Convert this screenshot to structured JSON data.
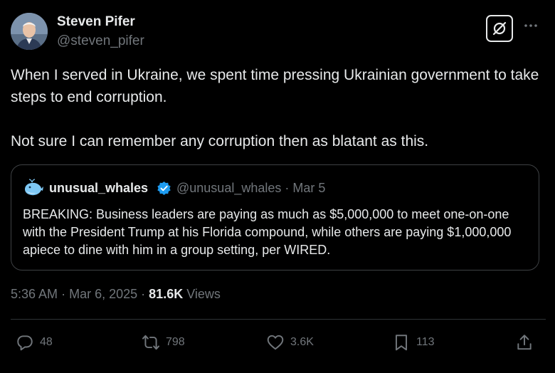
{
  "author": {
    "name": "Steven Pifer",
    "handle": "@steven_pifer",
    "avatar_icon": "person-avatar"
  },
  "header_icons": {
    "grok": "grok-icon",
    "more": "more-icon"
  },
  "tweet": {
    "lines": [
      "When I served in Ukraine, we spent time pressing Ukrainian government to take steps to end corruption.",
      "Not sure I can remember any corruption then as blatant as this."
    ]
  },
  "quoted_tweet": {
    "name": "unusual_whales",
    "verified_icon": "verified-badge-icon",
    "handle": "@unusual_whales",
    "separator": "·",
    "date": "Mar 5",
    "text": "BREAKING: Business leaders are paying as much as $5,000,000 to meet one-on-one with the President Trump at his Florida compound, while others are paying $1,000,000 apiece to dine with him in a group setting, per WIRED."
  },
  "meta": {
    "time": "5:36 AM",
    "separator": "·",
    "date": "Mar 6, 2025",
    "views_count": "81.6K",
    "views_label": "Views"
  },
  "actions": {
    "replies": "48",
    "reposts": "798",
    "likes": "3.6K",
    "bookmarks": "113"
  },
  "colors": {
    "background": "#000000",
    "text": "#e7e9ea",
    "muted": "#71767b",
    "border": "#2f3336",
    "verified": "#1d9bf0"
  }
}
